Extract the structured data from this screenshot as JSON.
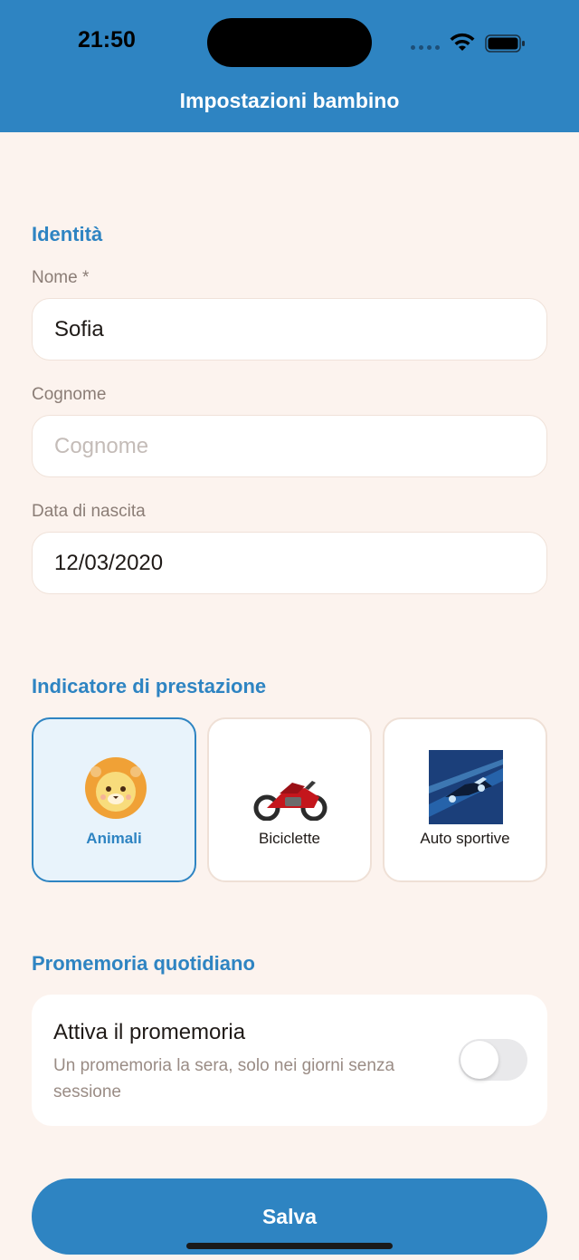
{
  "status_bar": {
    "time": "21:50"
  },
  "header": {
    "title": "Impostazioni bambino"
  },
  "identity": {
    "section_title": "Identità",
    "name_label": "Nome *",
    "name_value": "Sofia",
    "surname_label": "Cognome",
    "surname_placeholder": "Cognome",
    "birthdate_label": "Data di nascita",
    "birthdate_value": "12/03/2020"
  },
  "indicator": {
    "section_title": "Indicatore di prestazione",
    "options": [
      {
        "label": "Animali",
        "selected": true,
        "icon": "lion-icon"
      },
      {
        "label": "Biciclette",
        "selected": false,
        "icon": "motorcycle-icon"
      },
      {
        "label": "Auto sportive",
        "selected": false,
        "icon": "race-car-icon"
      }
    ]
  },
  "reminder": {
    "section_title": "Promemoria quotidiano",
    "title": "Attiva il promemoria",
    "description": "Un promemoria la sera, solo nei giorni senza sessione",
    "enabled": false
  },
  "save_button": {
    "label": "Salva"
  },
  "colors": {
    "accent": "#2e84c2",
    "background": "#fcf3ee",
    "selected_card_bg": "#e8f3fb"
  }
}
